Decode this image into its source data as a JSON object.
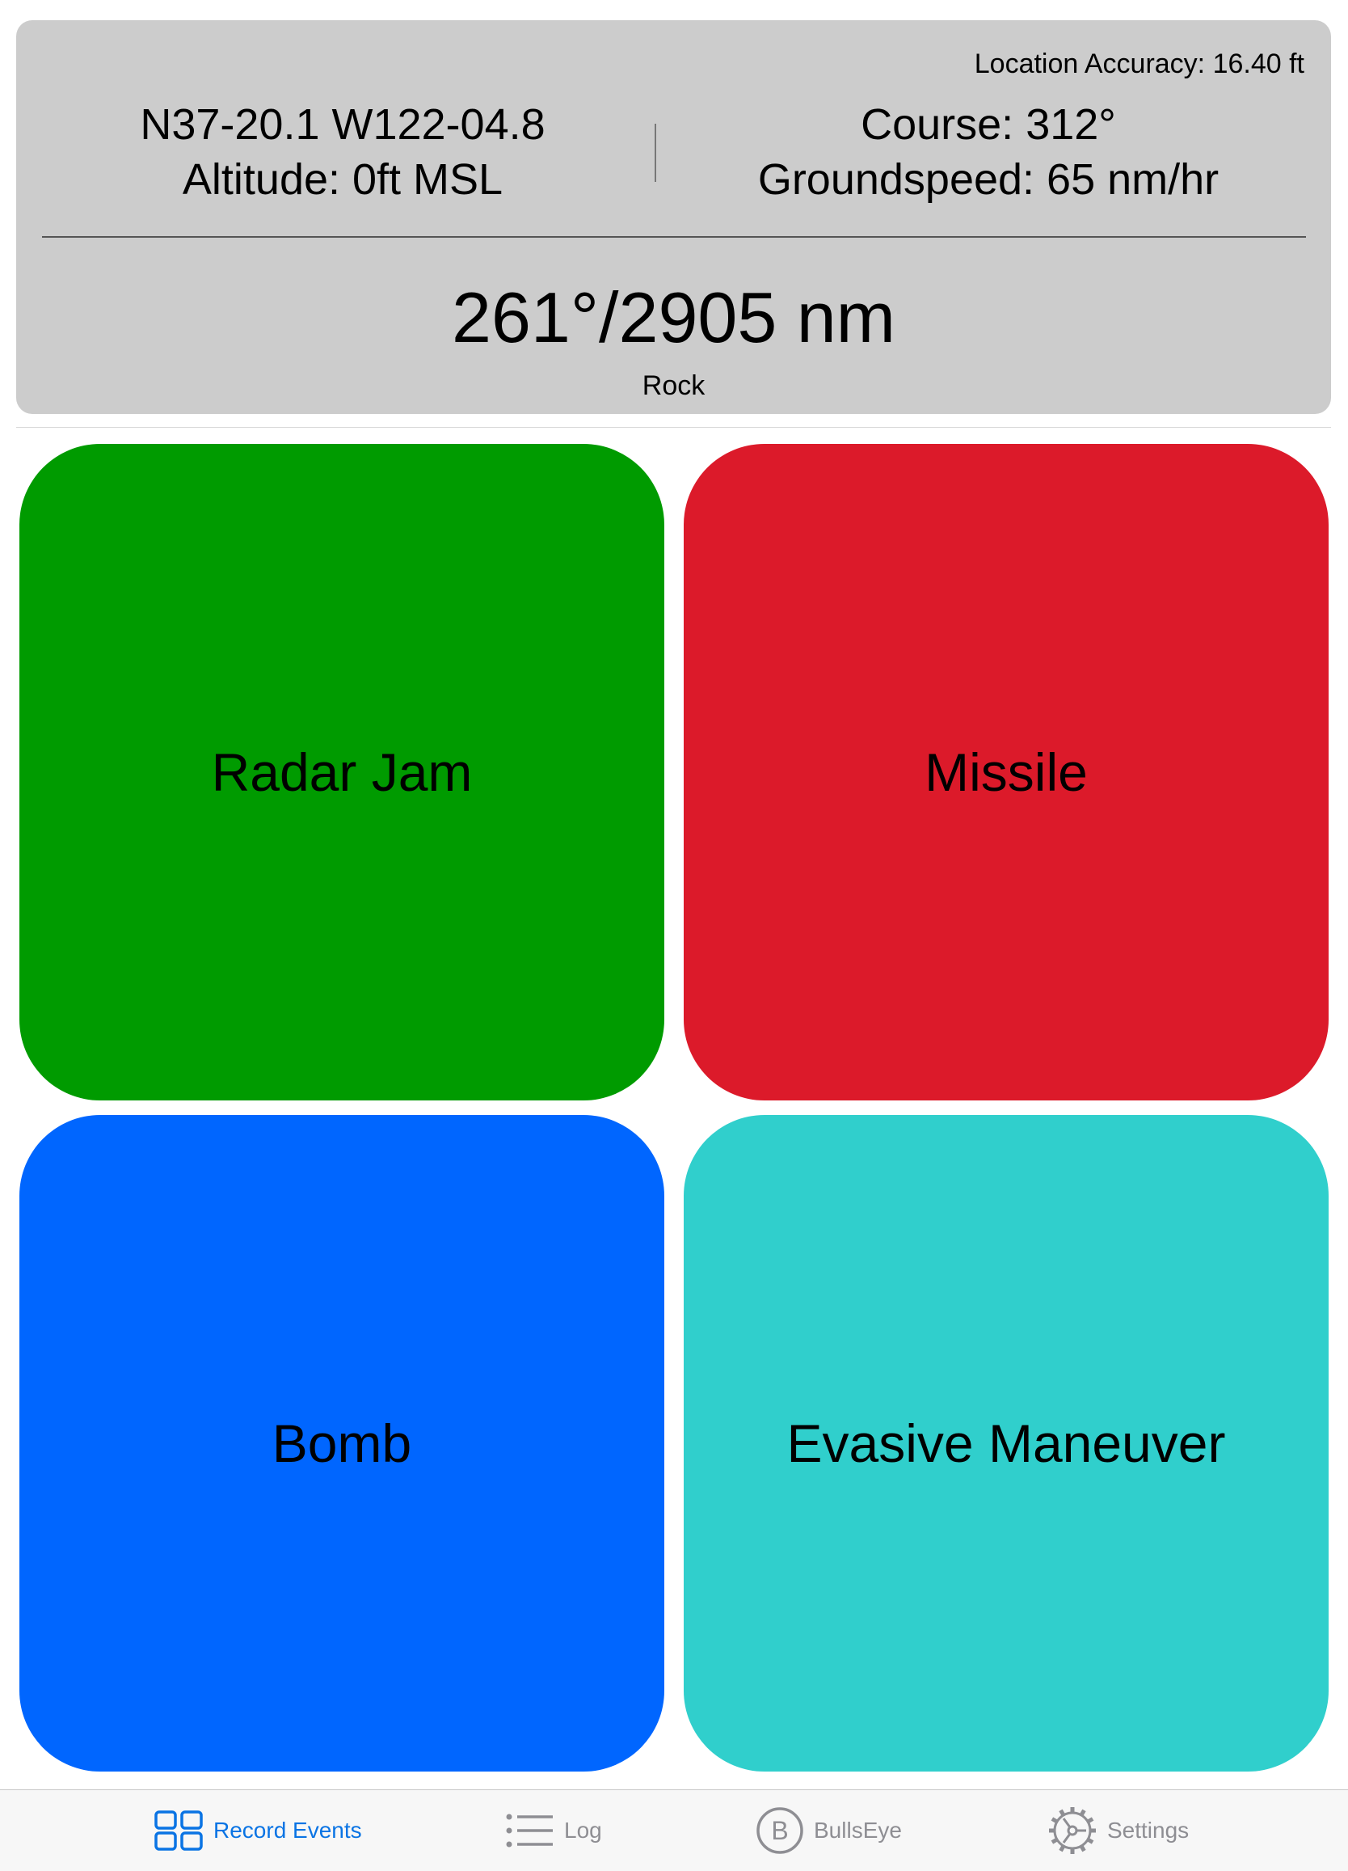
{
  "status": {
    "location_accuracy": "Location Accuracy: 16.40 ft",
    "coordinates": "N37-20.1 W122-04.8",
    "altitude": "Altitude: 0ft MSL",
    "course": "Course: 312°",
    "groundspeed": "Groundspeed: 65 nm/hr",
    "bearing_distance": "261°/2905 nm",
    "bearing_target": "Rock"
  },
  "events": [
    {
      "label": "Radar Jam",
      "color": "#009b00"
    },
    {
      "label": "Missile",
      "color": "#dc1a2a"
    },
    {
      "label": "Bomb",
      "color": "#0066ff"
    },
    {
      "label": "Evasive Maneuver",
      "color": "#30cfcc"
    }
  ],
  "tabs": [
    {
      "label": "Record Events",
      "icon": "grid-icon",
      "active": true
    },
    {
      "label": "Log",
      "icon": "list-icon",
      "active": false
    },
    {
      "label": "BullsEye",
      "icon": "bullseye-b-icon",
      "active": false
    },
    {
      "label": "Settings",
      "icon": "gear-icon",
      "active": false
    }
  ],
  "colors": {
    "tab_active": "#0a74e4",
    "tab_inactive": "#8e8e93",
    "panel_background": "#cccccc"
  }
}
